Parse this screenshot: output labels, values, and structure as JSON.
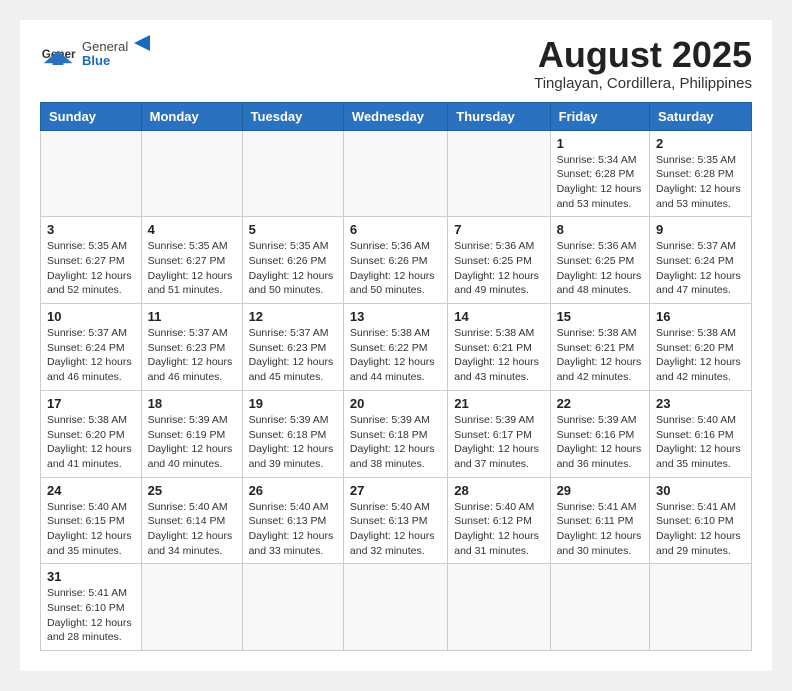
{
  "header": {
    "logo_general": "General",
    "logo_blue": "Blue",
    "month_year": "August 2025",
    "location": "Tinglayan, Cordillera, Philippines"
  },
  "weekdays": [
    "Sunday",
    "Monday",
    "Tuesday",
    "Wednesday",
    "Thursday",
    "Friday",
    "Saturday"
  ],
  "weeks": [
    [
      {
        "day": "",
        "info": ""
      },
      {
        "day": "",
        "info": ""
      },
      {
        "day": "",
        "info": ""
      },
      {
        "day": "",
        "info": ""
      },
      {
        "day": "",
        "info": ""
      },
      {
        "day": "1",
        "info": "Sunrise: 5:34 AM\nSunset: 6:28 PM\nDaylight: 12 hours\nand 53 minutes."
      },
      {
        "day": "2",
        "info": "Sunrise: 5:35 AM\nSunset: 6:28 PM\nDaylight: 12 hours\nand 53 minutes."
      }
    ],
    [
      {
        "day": "3",
        "info": "Sunrise: 5:35 AM\nSunset: 6:27 PM\nDaylight: 12 hours\nand 52 minutes."
      },
      {
        "day": "4",
        "info": "Sunrise: 5:35 AM\nSunset: 6:27 PM\nDaylight: 12 hours\nand 51 minutes."
      },
      {
        "day": "5",
        "info": "Sunrise: 5:35 AM\nSunset: 6:26 PM\nDaylight: 12 hours\nand 50 minutes."
      },
      {
        "day": "6",
        "info": "Sunrise: 5:36 AM\nSunset: 6:26 PM\nDaylight: 12 hours\nand 50 minutes."
      },
      {
        "day": "7",
        "info": "Sunrise: 5:36 AM\nSunset: 6:25 PM\nDaylight: 12 hours\nand 49 minutes."
      },
      {
        "day": "8",
        "info": "Sunrise: 5:36 AM\nSunset: 6:25 PM\nDaylight: 12 hours\nand 48 minutes."
      },
      {
        "day": "9",
        "info": "Sunrise: 5:37 AM\nSunset: 6:24 PM\nDaylight: 12 hours\nand 47 minutes."
      }
    ],
    [
      {
        "day": "10",
        "info": "Sunrise: 5:37 AM\nSunset: 6:24 PM\nDaylight: 12 hours\nand 46 minutes."
      },
      {
        "day": "11",
        "info": "Sunrise: 5:37 AM\nSunset: 6:23 PM\nDaylight: 12 hours\nand 46 minutes."
      },
      {
        "day": "12",
        "info": "Sunrise: 5:37 AM\nSunset: 6:23 PM\nDaylight: 12 hours\nand 45 minutes."
      },
      {
        "day": "13",
        "info": "Sunrise: 5:38 AM\nSunset: 6:22 PM\nDaylight: 12 hours\nand 44 minutes."
      },
      {
        "day": "14",
        "info": "Sunrise: 5:38 AM\nSunset: 6:21 PM\nDaylight: 12 hours\nand 43 minutes."
      },
      {
        "day": "15",
        "info": "Sunrise: 5:38 AM\nSunset: 6:21 PM\nDaylight: 12 hours\nand 42 minutes."
      },
      {
        "day": "16",
        "info": "Sunrise: 5:38 AM\nSunset: 6:20 PM\nDaylight: 12 hours\nand 42 minutes."
      }
    ],
    [
      {
        "day": "17",
        "info": "Sunrise: 5:38 AM\nSunset: 6:20 PM\nDaylight: 12 hours\nand 41 minutes."
      },
      {
        "day": "18",
        "info": "Sunrise: 5:39 AM\nSunset: 6:19 PM\nDaylight: 12 hours\nand 40 minutes."
      },
      {
        "day": "19",
        "info": "Sunrise: 5:39 AM\nSunset: 6:18 PM\nDaylight: 12 hours\nand 39 minutes."
      },
      {
        "day": "20",
        "info": "Sunrise: 5:39 AM\nSunset: 6:18 PM\nDaylight: 12 hours\nand 38 minutes."
      },
      {
        "day": "21",
        "info": "Sunrise: 5:39 AM\nSunset: 6:17 PM\nDaylight: 12 hours\nand 37 minutes."
      },
      {
        "day": "22",
        "info": "Sunrise: 5:39 AM\nSunset: 6:16 PM\nDaylight: 12 hours\nand 36 minutes."
      },
      {
        "day": "23",
        "info": "Sunrise: 5:40 AM\nSunset: 6:16 PM\nDaylight: 12 hours\nand 35 minutes."
      }
    ],
    [
      {
        "day": "24",
        "info": "Sunrise: 5:40 AM\nSunset: 6:15 PM\nDaylight: 12 hours\nand 35 minutes."
      },
      {
        "day": "25",
        "info": "Sunrise: 5:40 AM\nSunset: 6:14 PM\nDaylight: 12 hours\nand 34 minutes."
      },
      {
        "day": "26",
        "info": "Sunrise: 5:40 AM\nSunset: 6:13 PM\nDaylight: 12 hours\nand 33 minutes."
      },
      {
        "day": "27",
        "info": "Sunrise: 5:40 AM\nSunset: 6:13 PM\nDaylight: 12 hours\nand 32 minutes."
      },
      {
        "day": "28",
        "info": "Sunrise: 5:40 AM\nSunset: 6:12 PM\nDaylight: 12 hours\nand 31 minutes."
      },
      {
        "day": "29",
        "info": "Sunrise: 5:41 AM\nSunset: 6:11 PM\nDaylight: 12 hours\nand 30 minutes."
      },
      {
        "day": "30",
        "info": "Sunrise: 5:41 AM\nSunset: 6:10 PM\nDaylight: 12 hours\nand 29 minutes."
      }
    ],
    [
      {
        "day": "31",
        "info": "Sunrise: 5:41 AM\nSunset: 6:10 PM\nDaylight: 12 hours\nand 28 minutes."
      },
      {
        "day": "",
        "info": ""
      },
      {
        "day": "",
        "info": ""
      },
      {
        "day": "",
        "info": ""
      },
      {
        "day": "",
        "info": ""
      },
      {
        "day": "",
        "info": ""
      },
      {
        "day": "",
        "info": ""
      }
    ]
  ]
}
